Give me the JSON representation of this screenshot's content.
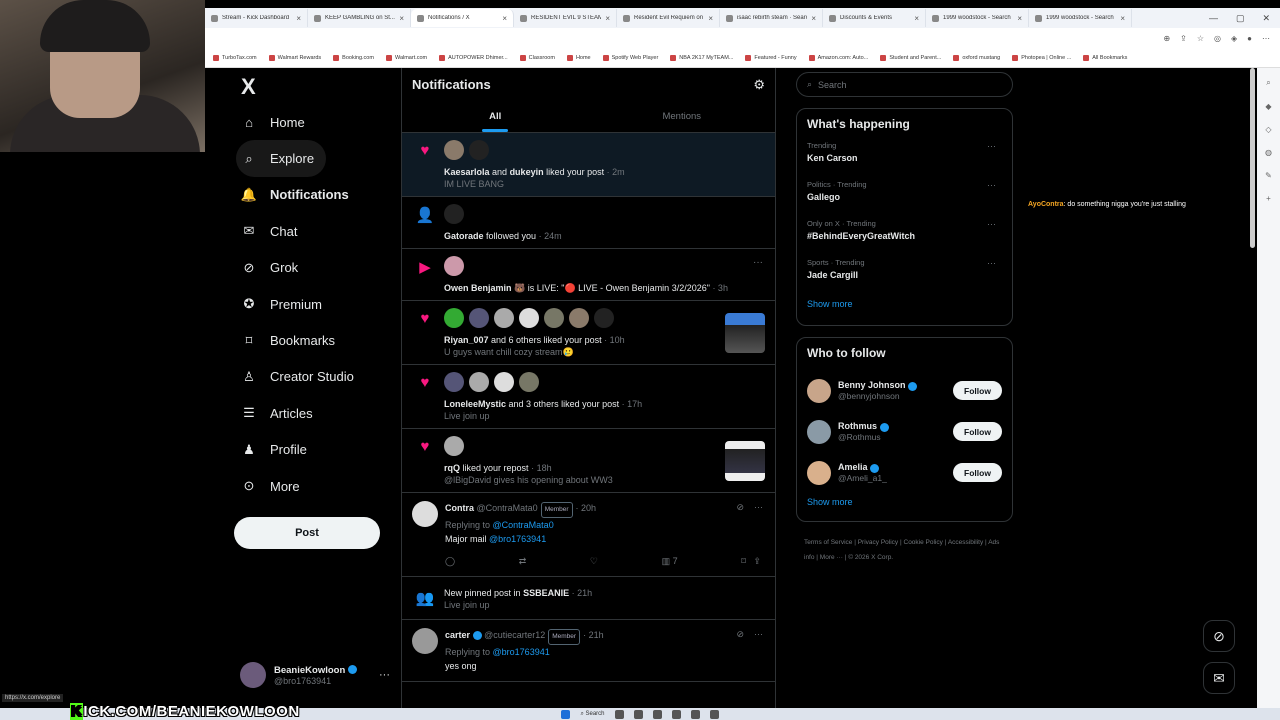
{
  "browser": {
    "tabs": [
      {
        "label": "Stream - Kick Dashboard"
      },
      {
        "label": "KEEP GAMBLING on St..."
      },
      {
        "label": "Notifications / X",
        "active": true
      },
      {
        "label": "RESIDENT EVIL 9 STEAM"
      },
      {
        "label": "Resident Evil Requiem on"
      },
      {
        "label": "isaac rebirth steam · Search"
      },
      {
        "label": "Discounts & Events"
      },
      {
        "label": "1999 woodstock - Search"
      },
      {
        "label": "1999 woodstock - Search"
      }
    ],
    "bookmarks": [
      "TurboTax.com",
      "Walmart Rewards",
      "Booking.com",
      "Walmart.com",
      "AUTOPOWER Dhimer...",
      "Classroom",
      "Home",
      "Spotify Web Player",
      "NBA 2K17 MyTEAM...",
      "Featured - Funny",
      "Amazon.com: Auto...",
      "Student and Parent...",
      "oxford mustang",
      "Photopea | Online ...",
      "All Bookmarks"
    ]
  },
  "sidebar": {
    "logo": "X",
    "items": [
      {
        "label": "Home",
        "icon": "home-icon"
      },
      {
        "label": "Explore",
        "icon": "search-icon"
      },
      {
        "label": "Notifications",
        "icon": "bell-icon",
        "active": true
      },
      {
        "label": "Chat",
        "icon": "mail-icon"
      },
      {
        "label": "Grok",
        "icon": "grok-icon"
      },
      {
        "label": "Premium",
        "icon": "premium-icon"
      },
      {
        "label": "Bookmarks",
        "icon": "bookmark-icon"
      },
      {
        "label": "Creator Studio",
        "icon": "creator-studio-icon"
      },
      {
        "label": "Articles",
        "icon": "article-icon"
      },
      {
        "label": "Profile",
        "icon": "person-icon"
      },
      {
        "label": "More",
        "icon": "more-circle-icon"
      }
    ],
    "post_label": "Post",
    "account": {
      "name": "BeanieKowloon",
      "handle": "@bro1763941"
    }
  },
  "main": {
    "title": "Notifications",
    "tabs": [
      "All",
      "Mentions"
    ],
    "notifications": [
      {
        "type": "like",
        "actor": "Kaesarlola",
        "joiner": " and ",
        "actor2": "dukeyin",
        "action": " liked your post",
        "time": "· 2m",
        "sub": "IM LIVE BANG"
      },
      {
        "type": "follow",
        "actor": "Gatorade",
        "action": " followed you",
        "time": "· 24m",
        "sub": ""
      },
      {
        "type": "live",
        "actor": "Owen Benjamin 🐻",
        "action": " is LIVE: \"🔴 LIVE - Owen Benjamin 3/2/2026\"",
        "time": "· 3h",
        "sub": ""
      },
      {
        "type": "like",
        "actor": "Riyan_007",
        "action": " and 6 others liked your post",
        "time": "· 10h",
        "sub": "U guys want chill cozy stream🥲"
      },
      {
        "type": "like",
        "actor": "LoneleeMystic",
        "action": " and 3 others liked your post",
        "time": "· 17h",
        "sub": "Live join up"
      },
      {
        "type": "like",
        "actor": "rqQ",
        "action": " liked your repost",
        "time": "· 18h",
        "sub": "@lBigDavid gives his opening about WW3"
      }
    ],
    "tweet1": {
      "name": "Contra",
      "handle": "@ContraMata0",
      "badge": "Member",
      "time": "· 20h",
      "replying": "Replying to ",
      "replying_to": "@ContraMata0",
      "text": "Major mail ",
      "mention": "@bro1763941",
      "views": "7"
    },
    "pinned": {
      "text": "New pinned post in ",
      "group": "SSBEANIE",
      "time": "· 21h",
      "sub": "Live join up"
    },
    "tweet2": {
      "name": "carter",
      "handle": "@cutiecarter12",
      "badge": "Member",
      "time": "· 21h",
      "replying": "Replying to ",
      "replying_to": "@bro1763941",
      "text": "yes ong"
    }
  },
  "right": {
    "search_placeholder": "Search",
    "happening_title": "What's happening",
    "trends": [
      {
        "category": "Trending",
        "title": "Ken Carson"
      },
      {
        "category": "Politics · Trending",
        "title": "Gallego"
      },
      {
        "category": "Only on X · Trending",
        "title": "#BehindEveryGreatWitch"
      },
      {
        "category": "Sports · Trending",
        "title": "Jade Cargill"
      }
    ],
    "show_more": "Show more",
    "wtf_title": "Who to follow",
    "who_to_follow": [
      {
        "name": "Benny Johnson",
        "handle": "@bennyjohnson"
      },
      {
        "name": "Rothmus",
        "handle": "@Rothmus"
      },
      {
        "name": "Amelia",
        "handle": "@Ameli_a1_"
      }
    ],
    "follow_label": "Follow",
    "footer": [
      "Terms of Service",
      "Privacy Policy",
      "Cookie Policy",
      "Accessibility",
      "Ads info",
      "More ···",
      "© 2026 X Corp."
    ]
  },
  "overlay": {
    "chat_user": "AyoContra",
    "chat_msg": ": do something nigga you're just stalling",
    "kick_banner": "ICK.COM/BEANIEKOWLOON",
    "kick_k": "K",
    "url_hint": "https://x.com/explore"
  },
  "colors": {
    "accent": "#1d9bf0",
    "like": "#f91880",
    "bg": "#000000"
  }
}
